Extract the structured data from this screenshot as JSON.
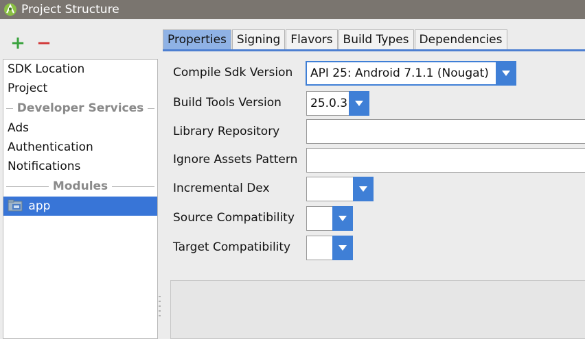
{
  "window": {
    "title": "Project Structure",
    "app_icon": "android-studio-icon"
  },
  "toolbar": {
    "add_label": "+",
    "remove_label": "−"
  },
  "sidebar": {
    "items_top": [
      {
        "label": "SDK Location"
      },
      {
        "label": "Project"
      }
    ],
    "developer_services_header": "Developer Services",
    "items_services": [
      {
        "label": "Ads"
      },
      {
        "label": "Authentication"
      },
      {
        "label": "Notifications"
      }
    ],
    "modules_header": "Modules",
    "modules": [
      {
        "label": "app",
        "icon": "module-folder-icon",
        "selected": true
      }
    ]
  },
  "tabs": [
    {
      "label": "Properties",
      "active": true
    },
    {
      "label": "Signing"
    },
    {
      "label": "Flavors"
    },
    {
      "label": "Build Types"
    },
    {
      "label": "Dependencies"
    }
  ],
  "form": {
    "compile_sdk": {
      "label": "Compile Sdk Version",
      "value": "API 25: Android 7.1.1 (Nougat)"
    },
    "build_tools": {
      "label": "Build Tools Version",
      "value": "25.0.3"
    },
    "library_repository": {
      "label": "Library Repository",
      "value": ""
    },
    "ignore_assets": {
      "label": "Ignore Assets Pattern",
      "value": ""
    },
    "incremental_dex": {
      "label": "Incremental Dex",
      "value": ""
    },
    "source_compat": {
      "label": "Source Compatibility",
      "value": ""
    },
    "target_compat": {
      "label": "Target Compatibility",
      "value": ""
    }
  },
  "colors": {
    "selection": "#3875d7",
    "accent": "#3f7fd6",
    "active_tab": "#8fb2e5",
    "titlebar": "#7a756f",
    "add": "#3aa33e",
    "remove": "#d23a3a"
  }
}
